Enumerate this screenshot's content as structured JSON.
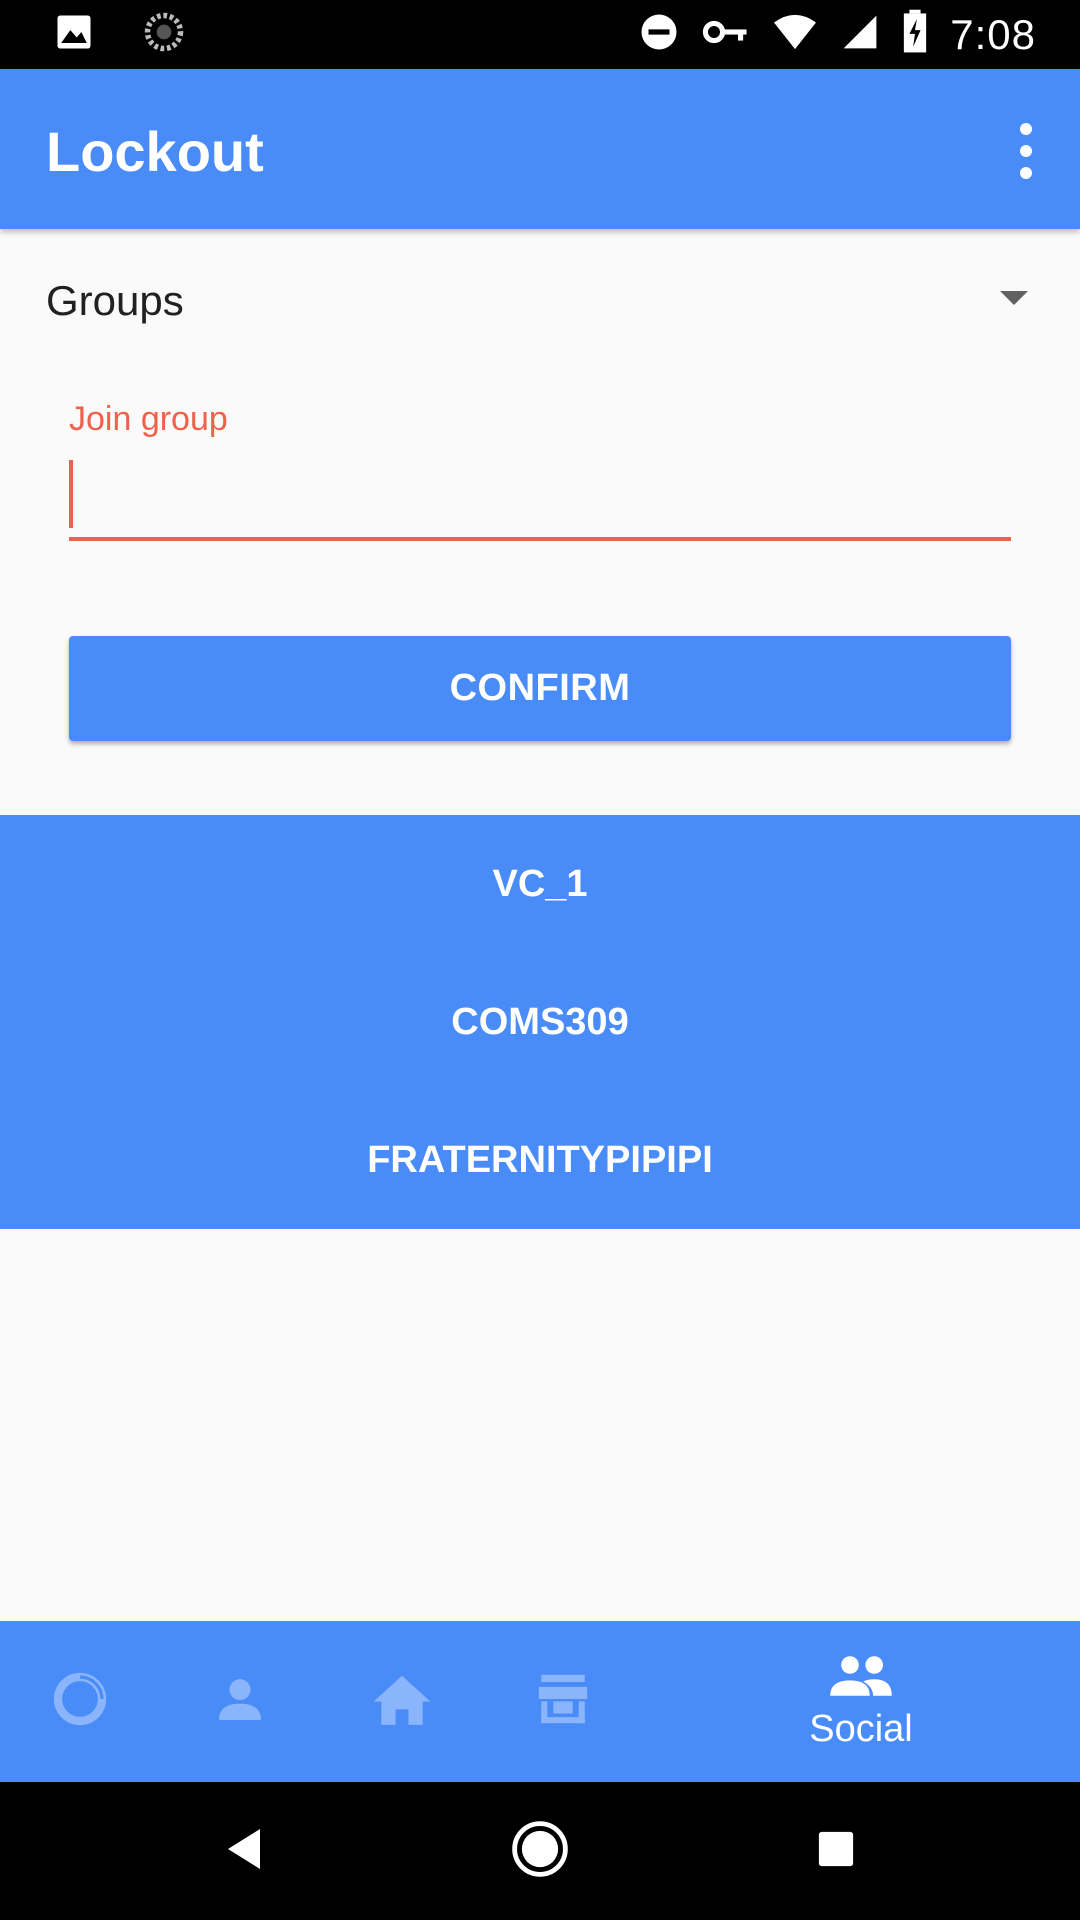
{
  "status_bar": {
    "time": "7:08"
  },
  "app_bar": {
    "title": "Lockout"
  },
  "groups_section": {
    "label": "Groups"
  },
  "join_group": {
    "label": "Join group",
    "value": ""
  },
  "confirm_button": {
    "label": "CONFIRM"
  },
  "group_list": [
    "VC_1",
    "COMS309",
    "FRATERNITYPIPIPI"
  ],
  "bottom_nav": {
    "items": [
      {
        "icon": "progress-ring-icon",
        "label": "",
        "active": false
      },
      {
        "icon": "person-icon",
        "label": "",
        "active": false
      },
      {
        "icon": "home-icon",
        "label": "",
        "active": false
      },
      {
        "icon": "store-icon",
        "label": "",
        "active": false
      },
      {
        "icon": "people-icon",
        "label": "Social",
        "active": true
      }
    ]
  },
  "colors": {
    "primary": "#4a8cf7",
    "accent_error": "#f0614c",
    "inactive_icon": "#8ab4fb",
    "background": "#fafafa"
  }
}
